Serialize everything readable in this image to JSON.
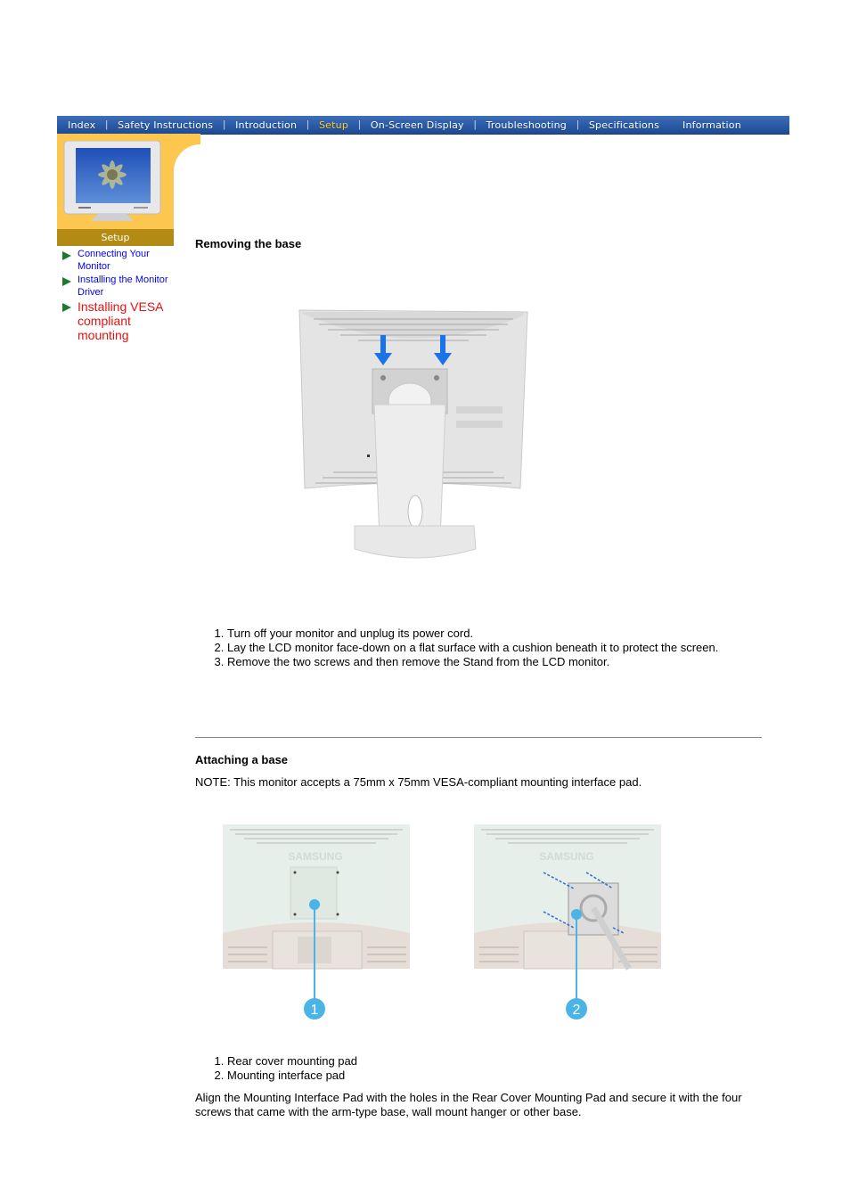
{
  "nav": {
    "items": [
      {
        "label": "Index",
        "active": false
      },
      {
        "label": "Safety Instructions",
        "active": false
      },
      {
        "label": "Introduction",
        "active": false
      },
      {
        "label": "Setup",
        "active": true
      },
      {
        "label": "On-Screen Display",
        "active": false
      },
      {
        "label": "Troubleshooting",
        "active": false
      },
      {
        "label": "Specifications",
        "active": false
      },
      {
        "label": "Information",
        "active": false
      }
    ],
    "separator": "|"
  },
  "sidebar": {
    "section_label": "Setup",
    "items": [
      {
        "label": "Connecting Your Monitor",
        "current": false
      },
      {
        "label": "Installing the Monitor Driver",
        "current": false
      },
      {
        "label": "Installing VESA compliant mounting",
        "current": true
      }
    ]
  },
  "removing": {
    "heading": "Removing the base",
    "steps": [
      "Turn off your monitor and unplug its power cord.",
      "Lay the LCD monitor face-down on a flat surface with a cushion beneath it to protect the screen.",
      "Remove the two screws and then remove the Stand from the LCD monitor."
    ]
  },
  "attaching": {
    "heading": "Attaching a base",
    "note": "NOTE: This monitor accepts a 75mm x 75mm VESA-compliant mounting interface pad.",
    "callouts": [
      "1",
      "2"
    ],
    "brand_text": "SAMSUNG",
    "parts": [
      "Rear cover mounting pad",
      "Mounting interface pad"
    ],
    "paragraph": "Align the Mounting Interface Pad with the holes in the Rear Cover Mounting Pad and secure it with the four screws that came with the arm-type base, wall mount hanger or other base."
  },
  "colors": {
    "nav_bg": "#2a5aa6",
    "nav_active": "#ffcc33",
    "sidebar_bg": "#fdc64f",
    "sidebar_label_bg": "#b38a13",
    "link": "#0000ee",
    "current_link": "#e81010",
    "bullet": "#1e7a2a",
    "arrow_blue": "#1a73e8",
    "callout_blue": "#4ab4e6"
  }
}
